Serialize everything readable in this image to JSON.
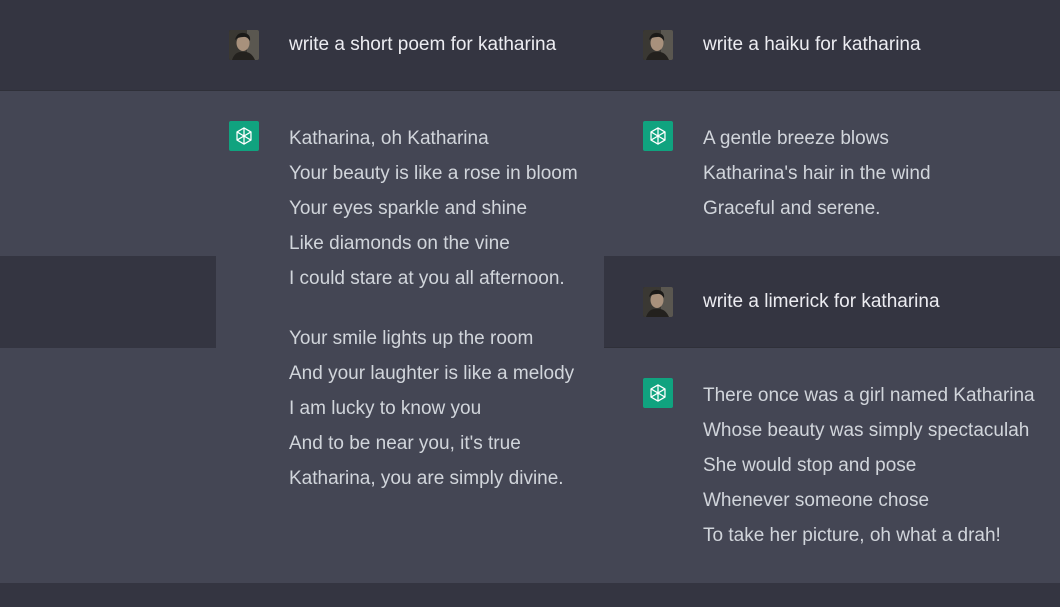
{
  "left": {
    "prompt": "write a short poem for katharina",
    "response": {
      "stanza1": [
        "Katharina, oh Katharina",
        "Your beauty is like a rose in bloom",
        "Your eyes sparkle and shine",
        "Like diamonds on the vine",
        "I could stare at you all afternoon."
      ],
      "stanza2": [
        "Your smile lights up the room",
        "And your laughter is like a melody",
        "I am lucky to know you",
        "And to be near you, it's true",
        "Katharina, you are simply divine."
      ]
    }
  },
  "right": {
    "prompt1": "write a haiku for katharina",
    "response1": [
      "A gentle breeze blows",
      "Katharina's hair in the wind",
      "Graceful and serene."
    ],
    "prompt2": "write a limerick for katharina",
    "response2": [
      "There once was a girl named Katharina",
      "Whose beauty was simply spectaculah",
      "She would stop and pose",
      "Whenever someone chose",
      "To take her picture, oh what a drah!"
    ]
  },
  "theme": {
    "user_band": "#343541",
    "bot_band": "#444654",
    "bot_avatar": "#10a37f",
    "text_user": "#ececf1",
    "text_bot": "#d1d5db"
  },
  "icons": {
    "user_avatar": "user-photo-avatar",
    "bot_avatar": "openai-logo-icon"
  }
}
